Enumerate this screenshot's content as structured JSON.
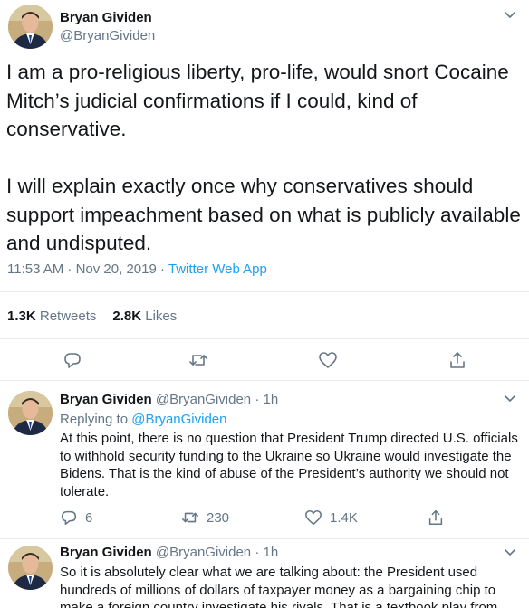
{
  "colors": {
    "text": "#14171a",
    "muted": "#657786",
    "link": "#1da1f2",
    "divider": "#e6ecf0"
  },
  "main": {
    "name": "Bryan Gividen",
    "handle": "@BryanGividen",
    "text": "I am a pro-religious liberty, pro-life, would snort Cocaine\nMitch’s judicial confirmations if I could, kind of\nconservative.\n\nI will explain exactly once why conservatives should\nsupport impeachment based on what is publicly available\nand undisputed.",
    "time": "11:53 AM · Nov 20, 2019 · ",
    "app": "Twitter Web App",
    "retweets_count": "1.3K",
    "retweets_label": "Retweets",
    "likes_count": "2.8K",
    "likes_label": "Likes",
    "icons": [
      "reply-icon",
      "retweet-icon",
      "like-icon",
      "share-icon"
    ]
  },
  "replies": [
    {
      "name": "Bryan Gividen",
      "handle": "@BryanGividen · 1h",
      "replying_label": "Replying to ",
      "replying_to": "@BryanGividen",
      "text": "At this point, there is no question that President Trump directed U.S. officials to withhold security funding to the Ukraine so Ukraine would investigate the Bidens. That is the kind of abuse of the President’s authority we should not tolerate.",
      "reply_count": "6",
      "retweet_count": "230",
      "like_count": "1.4K"
    },
    {
      "name": "Bryan Gividen",
      "handle": "@BryanGividen · 1h",
      "text": "So it is absolutely clear what we are talking about: the President used hundreds of millions of dollars of taxpayer money as a bargaining chip to make a foreign country investigate his rivals. That is a textbook play from"
    }
  ]
}
